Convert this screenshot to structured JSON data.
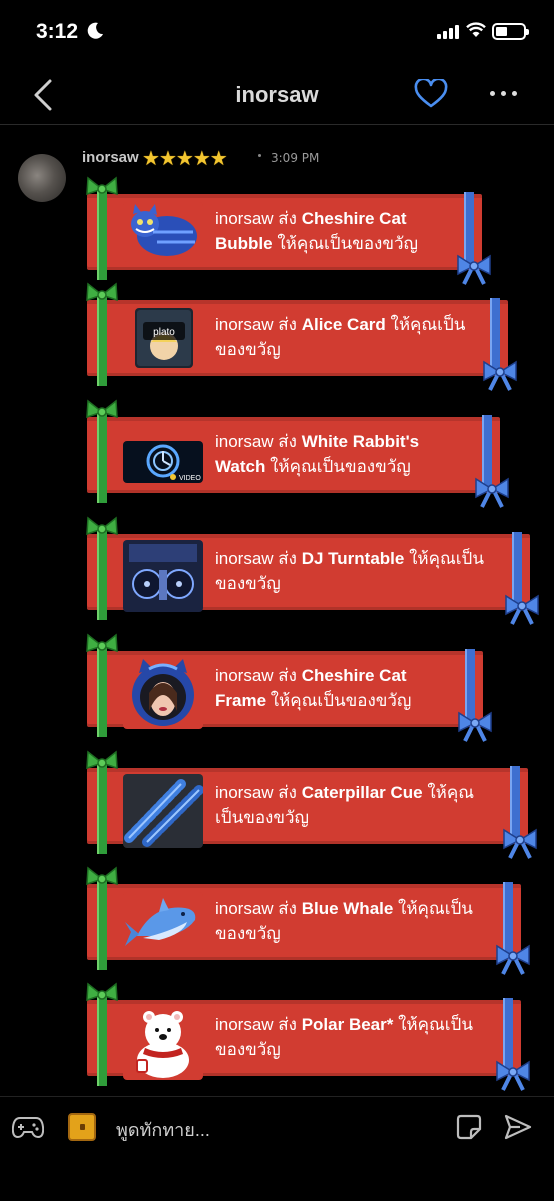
{
  "status_bar": {
    "time": "3:12"
  },
  "header": {
    "title": "inorsaw"
  },
  "message": {
    "sender": "inorsaw",
    "stars": [
      "★",
      "★",
      "★",
      "★",
      "★"
    ],
    "time": "3:09 PM"
  },
  "gifts": [
    {
      "prefix": "inorsaw ส่ง ",
      "item": "Cheshire Cat Bubble",
      "suffix": " ให้คุณเป็นของขวัญ",
      "icon": "cheshire-cat-bubble-icon"
    },
    {
      "prefix": "inorsaw ส่ง ",
      "item": "Alice Card",
      "suffix": " ให้คุณเป็นของขวัญ",
      "icon": "alice-card-icon",
      "thumb_text": "plato"
    },
    {
      "prefix": "inorsaw ส่ง ",
      "item": "White Rabbit's Watch",
      "suffix": " ให้คุณเป็นของขวัญ",
      "icon": "white-rabbit-watch-icon",
      "thumb_text": "VIDEO"
    },
    {
      "prefix": "inorsaw ส่ง ",
      "item": "DJ Turntable",
      "suffix": " ให้คุณเป็นของขวัญ",
      "icon": "dj-turntable-icon"
    },
    {
      "prefix": "inorsaw ส่ง ",
      "item": "Cheshire Cat Frame",
      "suffix": " ให้คุณเป็นของขวัญ",
      "icon": "cheshire-cat-frame-icon"
    },
    {
      "prefix": "inorsaw ส่ง ",
      "item": "Caterpillar Cue",
      "suffix": " ให้คุณเป็นของขวัญ",
      "icon": "caterpillar-cue-icon"
    },
    {
      "prefix": "inorsaw ส่ง ",
      "item": "Blue Whale",
      "suffix": " ให้คุณเป็นของขวัญ",
      "icon": "blue-whale-icon"
    },
    {
      "prefix": "inorsaw ส่ง ",
      "item": "Polar Bear*",
      "suffix": " ให้คุณเป็นของขวัญ",
      "icon": "polar-bear-icon"
    }
  ],
  "composer": {
    "placeholder": "พูดทักทาย..."
  },
  "colors": {
    "gift_red": "#d13c31",
    "ribbon_green": "#2f9d3a",
    "ribbon_blue": "#3e6fd0",
    "heart_blue": "#4a8ef0",
    "star_gold": "#f3c630"
  }
}
